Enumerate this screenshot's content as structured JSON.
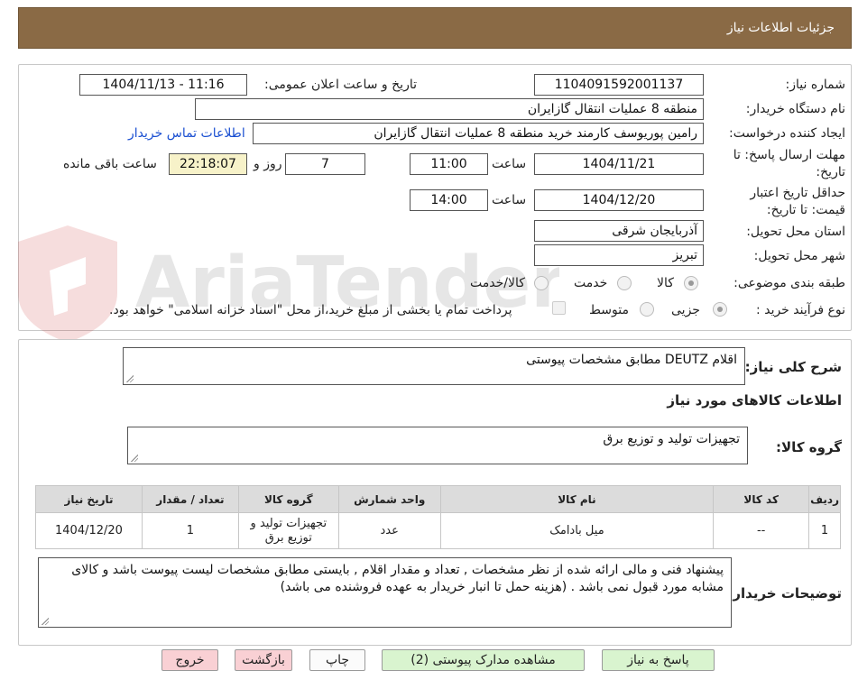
{
  "header": {
    "title": "جزئیات اطلاعات نیاز"
  },
  "watermark_text": "AriaTender.neT",
  "form": {
    "need_number_label": "شماره نیاز:",
    "need_number": "1104091592001137",
    "announce_label": "تاریخ و ساعت اعلان عمومی:",
    "announce_value": "1404/11/13 - 11:16",
    "buyer_org_label": "نام دستگاه خریدار:",
    "buyer_org": "منطقه 8 عملیات انتقال گازایران",
    "creator_label": "ایجاد کننده درخواست:",
    "creator": "رامین پوریوسف کارمند خرید منطقه 8 عملیات انتقال گازایران",
    "contact_link": "اطلاعات تماس خریدار",
    "reply_deadline_label_1": "مهلت ارسال پاسخ: تا",
    "reply_deadline_label_2": "تاریخ:",
    "reply_date": "1404/11/21",
    "time_label": "ساعت",
    "reply_time": "11:00",
    "days_value": "7",
    "days_label": "روز و",
    "remaining_time": "22:18:07",
    "remaining_label": "ساعت باقی مانده",
    "validity_label_1": "حداقل تاریخ اعتبار",
    "validity_label_2": "قیمت: تا تاریخ:",
    "validity_date": "1404/12/20",
    "validity_time": "14:00",
    "province_label": "استان محل تحویل:",
    "province": "آذربایجان شرقی",
    "city_label": "شهر محل تحویل:",
    "city": "تبریز",
    "category_label": "طبقه بندی موضوعی:",
    "category_options": [
      "کالا",
      "خدمت",
      "کالا/خدمت"
    ],
    "category_selected": "کالا",
    "process_label": "نوع فرآیند خرید :",
    "process_options": [
      "جزیی",
      "متوسط"
    ],
    "process_selected": "جزیی",
    "treasury_note": "پرداخت تمام یا بخشی از مبلغ خرید،از محل \"اسناد خزانه اسلامی\" خواهد بود."
  },
  "summary": {
    "desc_label": "شرح کلی نیاز:",
    "desc_value": "اقلام DEUTZ مطابق مشخصات پیوستی",
    "goods_info_title": "اطلاعات کالاهای مورد نیاز",
    "group_label": "گروه کالا:",
    "group_value": "تجهیزات تولید و توزیع برق"
  },
  "table": {
    "headers": [
      "ردیف",
      "کد کالا",
      "نام کالا",
      "واحد شمارش",
      "گروه کالا",
      "تعداد / مقدار",
      "تاریخ نیاز"
    ],
    "rows": [
      [
        "1",
        "--",
        "میل بادامک",
        "عدد",
        "تجهیزات تولید و توزیع برق",
        "1",
        "1404/12/20"
      ]
    ]
  },
  "buyer_notes": {
    "label": "توضیحات خریدار:",
    "text": "پیشنهاد فنی و مالی ارائه شده از نظر مشخصات , تعداد و مقدار اقلام , بایستی مطابق مشخصات لیست پیوست باشد و کالای مشابه مورد قبول نمی باشد . (هزینه حمل تا انبار خریدار به عهده فروشنده می باشد)"
  },
  "buttons": {
    "reply": "پاسخ به نیاز",
    "attachments": "مشاهده مدارک پیوستی (2)",
    "print": "چاپ",
    "back": "بازگشت",
    "exit": "خروج"
  },
  "colors": {
    "header_bg": "#8a6a45",
    "link": "#1a4fd1",
    "remaining_bg": "#f7f2c9",
    "green_button": "#d9f4cf",
    "pink_button": "#f9d0d4"
  }
}
